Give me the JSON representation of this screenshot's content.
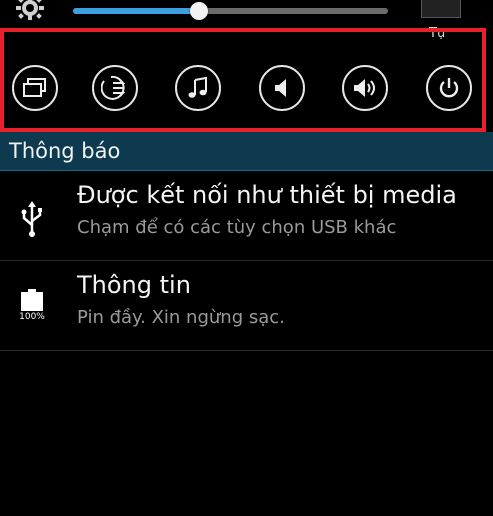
{
  "brightness": {
    "level_percent": 40,
    "auto_label": "Tự"
  },
  "quick_settings": [
    {
      "icon": "multi-window-icon"
    },
    {
      "icon": "data-sync-icon"
    },
    {
      "icon": "music-note-icon"
    },
    {
      "icon": "sound-mute-icon"
    },
    {
      "icon": "volume-icon"
    },
    {
      "icon": "power-icon"
    }
  ],
  "notifications_header": "Thông báo",
  "notifications": [
    {
      "title": "Được kết nối như thiết bị media",
      "subtitle": "Chạm để có các tùy chọn USB khác",
      "icon": "usb-icon"
    },
    {
      "title": "Thông tin",
      "subtitle": "Pin đầy.  Xin ngừng sạc.",
      "icon": "battery-full-icon",
      "icon_caption": "100%"
    }
  ],
  "colors": {
    "accent": "#3c9fe0",
    "highlight_border": "#e8202a",
    "header_bg": "#0d3a4f"
  }
}
